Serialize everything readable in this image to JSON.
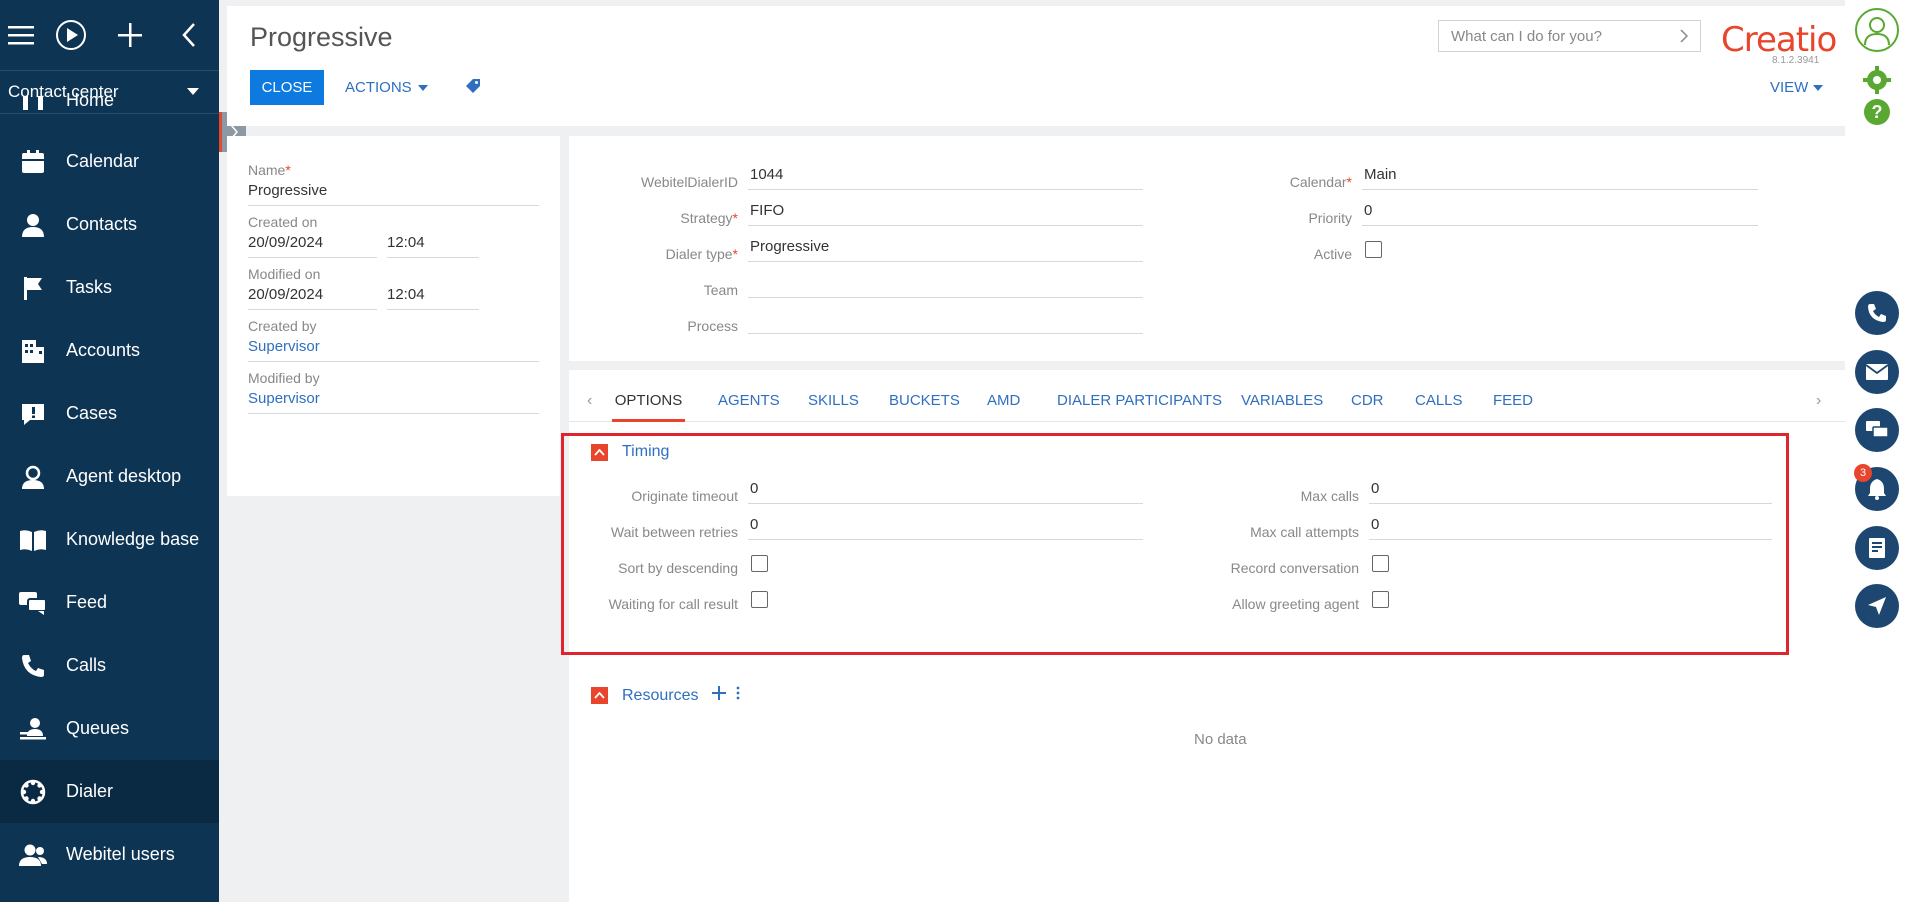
{
  "sidebar": {
    "workspace": "Contact center",
    "items": [
      {
        "label": "Home",
        "icon": "home-icon"
      },
      {
        "label": "Calendar",
        "icon": "calendar-icon"
      },
      {
        "label": "Contacts",
        "icon": "person-icon"
      },
      {
        "label": "Tasks",
        "icon": "flag-icon"
      },
      {
        "label": "Accounts",
        "icon": "building-icon"
      },
      {
        "label": "Cases",
        "icon": "exclamation-bubble-icon"
      },
      {
        "label": "Agent desktop",
        "icon": "agent-icon"
      },
      {
        "label": "Knowledge base",
        "icon": "book-icon"
      },
      {
        "label": "Feed",
        "icon": "chat-bubbles-icon"
      },
      {
        "label": "Calls",
        "icon": "phone-icon"
      },
      {
        "label": "Queues",
        "icon": "queue-icon"
      },
      {
        "label": "Dialer",
        "icon": "dialer-icon"
      },
      {
        "label": "Webitel users",
        "icon": "users-icon"
      }
    ],
    "active_item": "Dialer"
  },
  "header": {
    "title": "Progressive",
    "close_label": "CLOSE",
    "actions_label": "ACTIONS",
    "search_placeholder": "What can I do for you?",
    "logo": "Creatio",
    "version": "8.1.2.3941",
    "view_label": "VIEW"
  },
  "info_panel": {
    "name_label": "Name",
    "name_value": "Progressive",
    "created_on_label": "Created on",
    "created_on_date": "20/09/2024",
    "created_on_time": "12:04",
    "modified_on_label": "Modified on",
    "modified_on_date": "20/09/2024",
    "modified_on_time": "12:04",
    "created_by_label": "Created by",
    "created_by_value": "Supervisor",
    "modified_by_label": "Modified by",
    "modified_by_value": "Supervisor"
  },
  "form": {
    "webitel_dialer_id_label": "WebitelDialerID",
    "webitel_dialer_id_value": "1044",
    "strategy_label": "Strategy",
    "strategy_value": "FIFO",
    "dialer_type_label": "Dialer type",
    "dialer_type_value": "Progressive",
    "team_label": "Team",
    "team_value": "",
    "process_label": "Process",
    "process_value": "",
    "calendar_label": "Calendar",
    "calendar_value": "Main",
    "priority_label": "Priority",
    "priority_value": "0",
    "active_label": "Active",
    "active_checked": false
  },
  "tabs": [
    "OPTIONS",
    "AGENTS",
    "SKILLS",
    "BUCKETS",
    "AMD",
    "DIALER PARTICIPANTS",
    "VARIABLES",
    "CDR",
    "CALLS",
    "FEED"
  ],
  "active_tab": "OPTIONS",
  "timing": {
    "title": "Timing",
    "originate_timeout_label": "Originate timeout",
    "originate_timeout_value": "0",
    "wait_between_retries_label": "Wait between retries",
    "wait_between_retries_value": "0",
    "sort_by_descending_label": "Sort by descending",
    "waiting_for_call_result_label": "Waiting for call result",
    "max_calls_label": "Max calls",
    "max_calls_value": "0",
    "max_call_attempts_label": "Max call attempts",
    "max_call_attempts_value": "0",
    "record_conversation_label": "Record conversation",
    "allow_greeting_agent_label": "Allow greeting agent"
  },
  "resources": {
    "title": "Resources",
    "empty_text": "No data"
  },
  "rail": {
    "notification_count": "3"
  },
  "colors": {
    "sidebar_bg": "#0e3454",
    "accent_blue": "#0d7ae0",
    "brand_orange": "#e8452c",
    "highlight_red": "#e0242e"
  }
}
